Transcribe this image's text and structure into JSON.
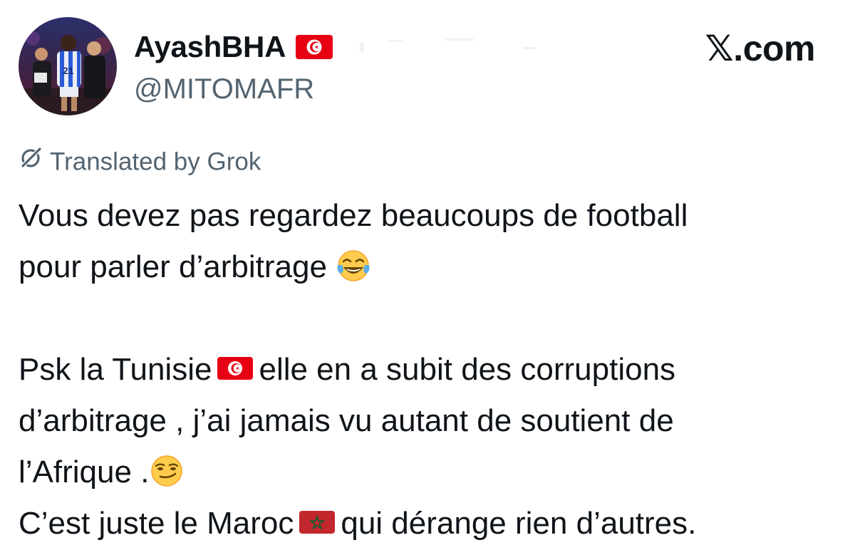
{
  "author": {
    "display_name": "AyashBHA",
    "handle": "@MITOMAFR",
    "name_flag_icon": "tunisia-flag-icon",
    "avatar_icon": "avatar-football-player"
  },
  "brand": {
    "label": "𝕏.com"
  },
  "translation": {
    "icon": "grok-icon",
    "label": "Translated by Grok"
  },
  "tweet": {
    "line1": "Vous devez pas regardez beaucoups de football",
    "line2": "pour parler d’arbitrage",
    "line2_emoji": "face-with-tears-of-joy-emoji",
    "line3_a": "Psk la Tunisie",
    "line3_flag": "tunisia-flag-icon",
    "line3_b": "elle en a subit des corruptions",
    "line4": "d’arbitrage ,  j’ai jamais vu autant de soutient de",
    "line5": "l’Afrique .",
    "line5_emoji": "smirking-face-emoji",
    "line6_a": "C’est juste le Maroc",
    "line6_flag": "morocco-flag-icon",
    "line6_b": "qui dérange rien d’autres."
  },
  "colors": {
    "text": "#0f1419",
    "secondary": "#536471",
    "tunisia_red": "#e70013",
    "morocco_red": "#c1272d",
    "morocco_green": "#006233"
  }
}
